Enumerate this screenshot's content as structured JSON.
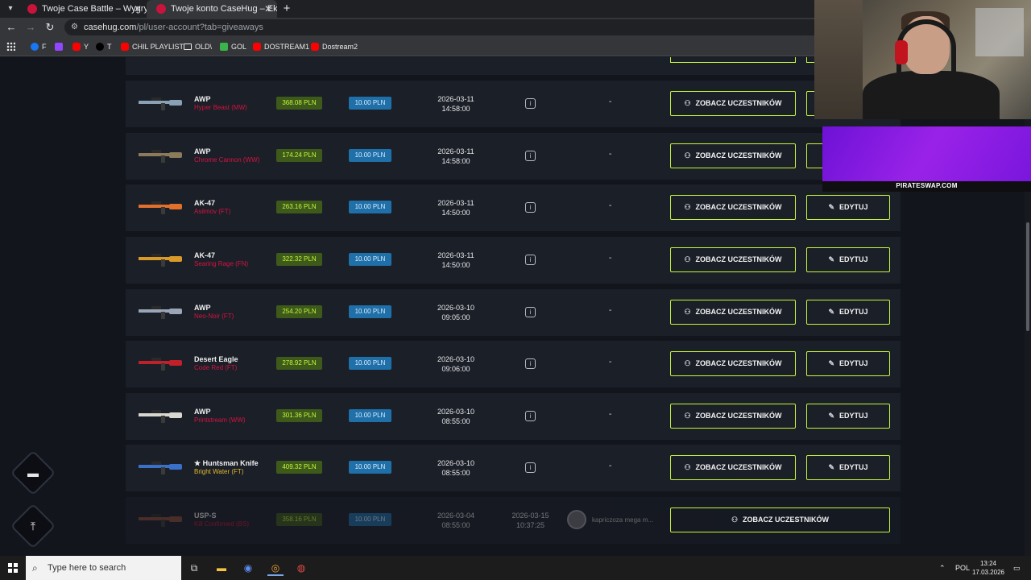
{
  "browser": {
    "tabs": [
      {
        "title": "Twoje Case Battle – Wygrywaj s"
      },
      {
        "title": "Twoje konto CaseHug – Ekwipu"
      }
    ],
    "url_host": "casehug.com",
    "url_path": "/pl/user-account?tab=giveaways",
    "bookmarks": [
      {
        "label": "F",
        "color": "#1877f2"
      },
      {
        "label": "",
        "color": "#9146ff"
      },
      {
        "label": "Y",
        "color": "#ff0000"
      },
      {
        "label": "T",
        "color": "#000000"
      },
      {
        "label": "CHIL PLAYLIST",
        "color": "#ff0000"
      },
      {
        "label": "OLD\\",
        "color": "folder"
      },
      {
        "label": "GOL",
        "color": "#3ab54a"
      },
      {
        "label": "DOSTREAM1",
        "color": "#ff0000"
      },
      {
        "label": "Dostream2",
        "color": "#ff0000"
      }
    ]
  },
  "common": {
    "participants_label": "ZOBACZ UCZESTNIKÓW",
    "edit_label": "EDYTUJ",
    "dash": "-"
  },
  "giveaways": [
    {
      "weapon": "AWP",
      "skin": "Hyper Beast (MW)",
      "price": "368.08 PLN",
      "entry": "10.00 PLN",
      "date": "2026-03-11",
      "time": "14:58:00",
      "editable": true,
      "img_color": "#8aa0b4"
    },
    {
      "weapon": "AWP",
      "skin": "Chrome Cannon (WW)",
      "price": "174.24 PLN",
      "entry": "10.00 PLN",
      "date": "2026-03-11",
      "time": "14:58:00",
      "editable": true,
      "img_color": "#8b7b5a"
    },
    {
      "weapon": "AK-47",
      "skin": "Asiimov (FT)",
      "price": "263.16 PLN",
      "entry": "10.00 PLN",
      "date": "2026-03-11",
      "time": "14:50:00",
      "editable": true,
      "img_color": "#e0702c"
    },
    {
      "weapon": "AK-47",
      "skin": "Searing Rage (FN)",
      "price": "322.32 PLN",
      "entry": "10.00 PLN",
      "date": "2026-03-11",
      "time": "14:50:00",
      "editable": true,
      "img_color": "#d99a2a"
    },
    {
      "weapon": "AWP",
      "skin": "Neo-Noir (FT)",
      "price": "254.20 PLN",
      "entry": "10.00 PLN",
      "date": "2026-03-10",
      "time": "09:05:00",
      "editable": true,
      "img_color": "#9aa6b8"
    },
    {
      "weapon": "Desert Eagle",
      "skin": "Code Red (FT)",
      "price": "278.92 PLN",
      "entry": "10.00 PLN",
      "date": "2026-03-10",
      "time": "09:06:00",
      "editable": true,
      "img_color": "#c0202a"
    },
    {
      "weapon": "AWP",
      "skin": "Printstream (WW)",
      "price": "301.36 PLN",
      "entry": "10.00 PLN",
      "date": "2026-03-10",
      "time": "08:55:00",
      "editable": true,
      "img_color": "#d8d8d0"
    },
    {
      "weapon": "★ Huntsman Knife",
      "skin": "Bright Water (FT)",
      "price": "409.32 PLN",
      "entry": "10.00 PLN",
      "date": "2026-03-10",
      "time": "08:55:00",
      "editable": true,
      "img_color": "#3a70c8"
    }
  ],
  "finished": {
    "weapon": "USP-S",
    "skin": "Kill Confirmed (BS)",
    "price": "358.16 PLN",
    "entry": "10.00 PLN",
    "date": "2026-03-04",
    "time": "08:55:00",
    "end_date": "2026-03-15",
    "end_time": "10:37:25",
    "winner": "kapriczoza mega m..."
  },
  "overlay": {
    "promo_text": "PIRATESWAP.COM"
  },
  "taskbar": {
    "search_placeholder": "Type here to search",
    "lang": "POL",
    "time": "13:24",
    "date": "17.03.2026"
  }
}
